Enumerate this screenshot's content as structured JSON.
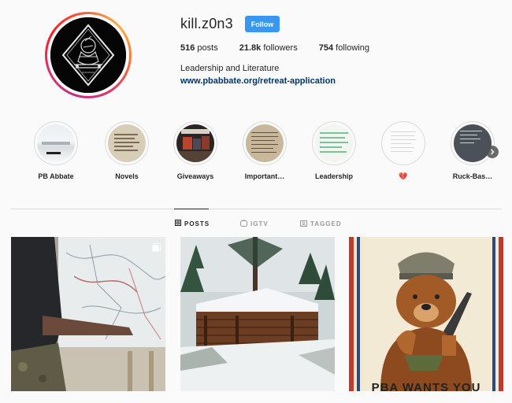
{
  "profile": {
    "username": "kill.z0n3",
    "follow_label": "Follow",
    "stats": {
      "posts_count": "516",
      "posts_label": "posts",
      "followers_count": "21.8k",
      "followers_label": "followers",
      "following_count": "754",
      "following_label": "following"
    },
    "bio": "Leadership and Literature",
    "link": "www.pbabbate.org/retreat-application"
  },
  "highlights": [
    {
      "label": "PB Abbate",
      "icon": "snow-landscape-thumbnail"
    },
    {
      "label": "Novels",
      "icon": "book-pages-thumbnail"
    },
    {
      "label": "Giveaways",
      "icon": "books-stack-thumbnail"
    },
    {
      "label": "Important…",
      "icon": "document-thumbnail"
    },
    {
      "label": "Leadership",
      "icon": "handwritten-note-thumbnail"
    },
    {
      "label": "💔",
      "icon": "hearts-emoji-thumbnail"
    },
    {
      "label": "Ruck-Bas…",
      "icon": "dark-text-thumbnail"
    }
  ],
  "tabs": [
    {
      "label": "POSTS",
      "icon": "grid-icon",
      "active": true
    },
    {
      "label": "IGTV",
      "icon": "igtv-icon",
      "active": false
    },
    {
      "label": "TAGGED",
      "icon": "tagged-icon",
      "active": false
    }
  ],
  "posts": [
    {
      "icon": "map-photo",
      "multi": true
    },
    {
      "icon": "snowy-cabin-photo",
      "multi": false
    },
    {
      "icon": "bear-poster-photo",
      "multi": false,
      "caption": "PBA WANTS YOU"
    }
  ],
  "colors": {
    "follow_button": "#3897f0",
    "link": "#003569",
    "background": "#fafafa",
    "divider": "#dbdbdb"
  }
}
